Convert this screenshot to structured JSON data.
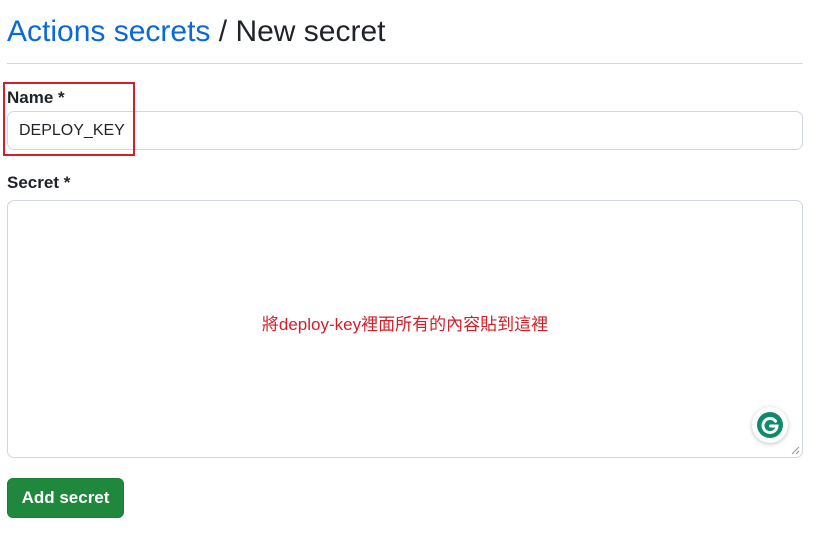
{
  "header": {
    "breadcrumb_link": "Actions secrets",
    "separator": " / ",
    "current": "New secret"
  },
  "form": {
    "name_label": "Name *",
    "name_value": "DEPLOY_KEY",
    "secret_label": "Secret *",
    "secret_annotation": "將deploy-key裡面所有的內容貼到這裡",
    "submit_label": "Add secret"
  },
  "colors": {
    "link": "#0969da",
    "annotation": "#d0202a",
    "button": "#1f883d",
    "grammarly": "#15c39a"
  },
  "icons": {
    "grammarly": "grammarly-icon",
    "resize": "resize-handle-icon"
  }
}
